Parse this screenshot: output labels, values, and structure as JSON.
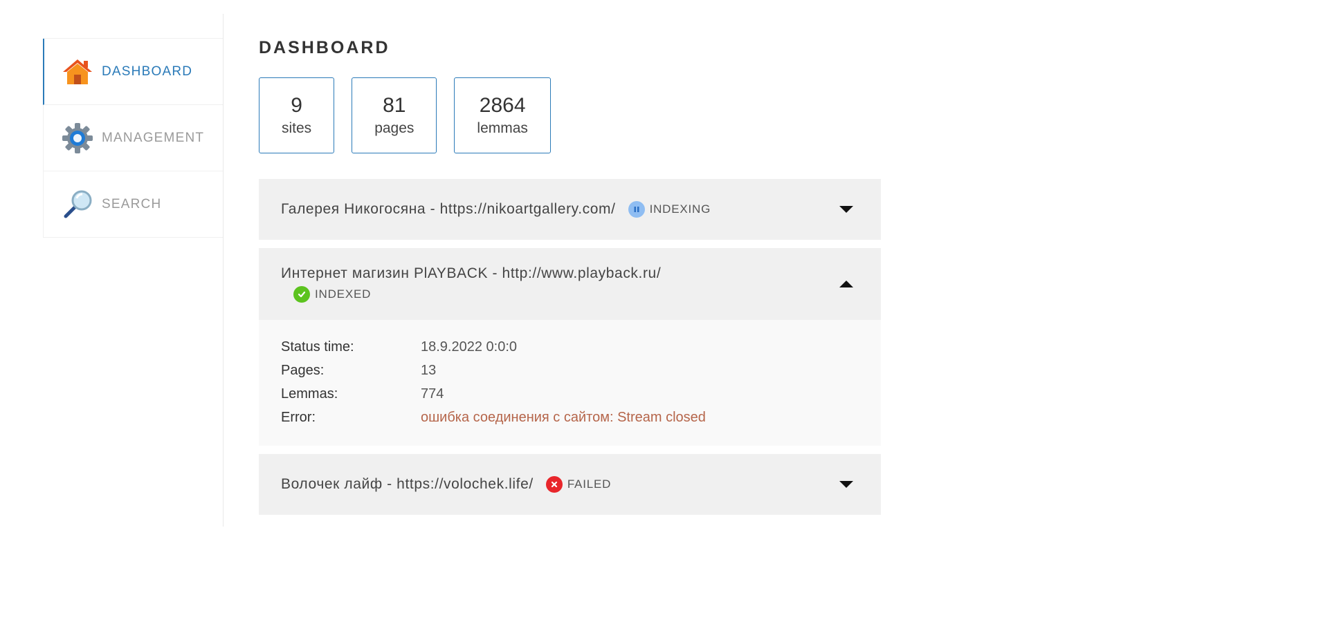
{
  "sidebar": {
    "items": [
      {
        "label": "DASHBOARD",
        "icon": "home-icon",
        "active": true
      },
      {
        "label": "MANAGEMENT",
        "icon": "gear-icon",
        "active": false
      },
      {
        "label": "SEARCH",
        "icon": "magnifier-icon",
        "active": false
      }
    ]
  },
  "main": {
    "title": "DASHBOARD",
    "stats": [
      {
        "value": "9",
        "label": "sites"
      },
      {
        "value": "81",
        "label": "pages"
      },
      {
        "value": "2864",
        "label": "lemmas"
      }
    ],
    "sites": [
      {
        "title": "Галерея Никогосяна - https://nikoartgallery.com/",
        "status": "INDEXING",
        "status_icon": "pause-icon",
        "expanded": false
      },
      {
        "title": "Интернет магизин PlAYBACK - http://www.playback.ru/",
        "status": "INDEXED",
        "status_icon": "check-icon",
        "expanded": true,
        "details": [
          {
            "key": "Status time:",
            "value": "18.9.2022 0:0:0"
          },
          {
            "key": "Pages:",
            "value": "13"
          },
          {
            "key": "Lemmas:",
            "value": "774"
          },
          {
            "key": "Error:",
            "value": "ошибка соединения с сайтом: Stream closed"
          }
        ]
      },
      {
        "title": "Волочек лайф - https://volochek.life/",
        "status": "FAILED",
        "status_icon": "x-icon",
        "expanded": false
      }
    ]
  },
  "colors": {
    "accent": "#2a7ab8",
    "error_text": "#b5654a",
    "indexing": "#7fb3f0",
    "indexed": "#5cc31f",
    "failed": "#e8262b"
  }
}
